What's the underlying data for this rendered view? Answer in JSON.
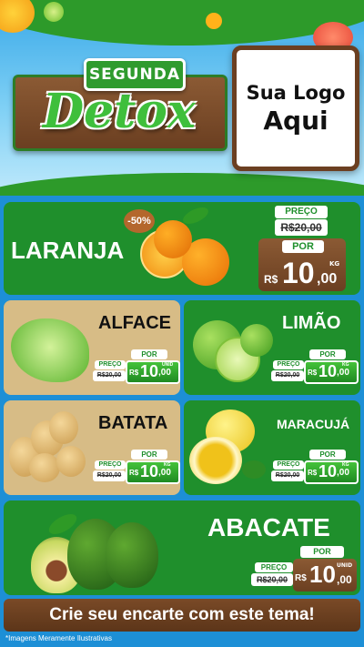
{
  "header": {
    "sign_top": "SEGUNDA",
    "sign_main": "Detox",
    "logo_line1": "Sua Logo",
    "logo_line2": "Aqui"
  },
  "products": [
    {
      "name": "LARANJA",
      "badge": "-50%",
      "preco_label": "PREÇO",
      "old_price": "R$20,00",
      "por_label": "POR",
      "currency": "R$",
      "price_int": "10",
      "price_dec": ",00",
      "unit": "KG"
    },
    {
      "name": "ALFACE",
      "preco_label": "PREÇO",
      "old_price": "R$20,00",
      "por_label": "POR",
      "currency": "R$",
      "price_int": "10",
      "price_dec": ",00",
      "unit": "UNID"
    },
    {
      "name": "LIMÃO",
      "preco_label": "PREÇO",
      "old_price": "R$20,00",
      "por_label": "POR",
      "currency": "R$",
      "price_int": "10",
      "price_dec": ",00",
      "unit": "KG"
    },
    {
      "name": "BATATA",
      "preco_label": "PREÇO",
      "old_price": "R$20,00",
      "por_label": "POR",
      "currency": "R$",
      "price_int": "10",
      "price_dec": ",00",
      "unit": "KG"
    },
    {
      "name": "MARACUJÁ",
      "preco_label": "PREÇO",
      "old_price": "R$20,00",
      "por_label": "POR",
      "currency": "R$",
      "price_int": "10",
      "price_dec": ",00",
      "unit": "KG"
    },
    {
      "name": "ABACATE",
      "preco_label": "PREÇO",
      "old_price": "R$20,00",
      "por_label": "POR",
      "currency": "R$",
      "price_int": "10",
      "price_dec": ",00",
      "unit": "UNID"
    }
  ],
  "banner": "Crie seu encarte com este tema!",
  "footnote": "*Imagens Meramente Ilustrativas",
  "colors": {
    "green": "#1f8f2c",
    "tan": "#d7bc86",
    "wood": "#6b3f21",
    "sky": "#38a8e8"
  }
}
